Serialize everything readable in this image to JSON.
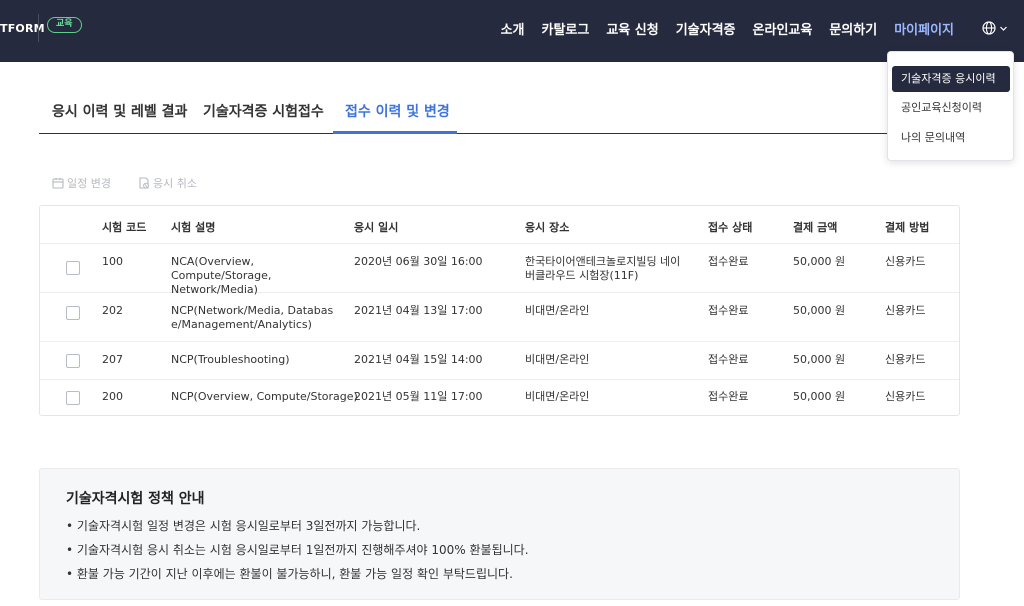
{
  "header": {
    "logo_text": "TFORM",
    "badge": "교육",
    "nav": [
      "소개",
      "카탈로그",
      "교육 신청",
      "기술자격증",
      "온라인교육",
      "문의하기",
      "마이페이지"
    ],
    "active_nav": "마이페이지",
    "lang_icon": "globe-icon"
  },
  "dropdown": {
    "items": [
      "기술자격증 응시이력",
      "공인교육신청이력",
      "나의 문의내역"
    ],
    "active_item": "기술자격증 응시이력"
  },
  "tabs": {
    "items": [
      "응시 이력 및 레벨 결과",
      "기술자격증 시험접수",
      "접수 이력 및 변경"
    ],
    "active": "접수 이력 및 변경"
  },
  "actions": {
    "change_label": "일정 변경",
    "cancel_label": "응시 취소"
  },
  "table": {
    "headers": [
      "시험 코드",
      "시험 설명",
      "응시 일시",
      "응시 장소",
      "접수 상태",
      "결제 금액",
      "결제 방법"
    ],
    "rows": [
      {
        "code": "100",
        "desc": "NCA(Overview, Compute/Storage, Network/Media)",
        "date": "2020년 06월 30일 16:00",
        "place": "한국타이어앤테크놀로지빌딩 네이버클라우드 시험장(11F)",
        "status": "접수완료",
        "amount": "50,000 원",
        "method": "신용카드"
      },
      {
        "code": "202",
        "desc": "NCP(Network/Media, Database/Management/Analytics)",
        "date": "2021년 04월 13일 17:00",
        "place": "비대면/온라인",
        "status": "접수완료",
        "amount": "50,000 원",
        "method": "신용카드"
      },
      {
        "code": "207",
        "desc": "NCP(Troubleshooting)",
        "date": "2021년 04월 15일 14:00",
        "place": "비대면/온라인",
        "status": "접수완료",
        "amount": "50,000 원",
        "method": "신용카드"
      },
      {
        "code": "200",
        "desc": "NCP(Overview, Compute/Storage)",
        "date": "2021년 05월 11일 17:00",
        "place": "비대면/온라인",
        "status": "접수완료",
        "amount": "50,000 원",
        "method": "신용카드"
      }
    ]
  },
  "policy": {
    "title": "기술자격시험 정책 안내",
    "items": [
      "• 기술자격시험 일정 변경은 시험 응시일로부터 3일전까지 가능합니다.",
      "• 기술자격시험 응시 취소는 시험 응시일로부터 1일전까지 진행해주셔야 100% 환불됩니다.",
      "• 환불 가능 기간이 지난 이후에는 환불이 불가능하니, 환불 가능 일정 확인 부탁드립니다."
    ]
  },
  "colors": {
    "header_bg": "#262a3e",
    "accent": "#3f75d9",
    "badge_green": "#5bd08a"
  }
}
